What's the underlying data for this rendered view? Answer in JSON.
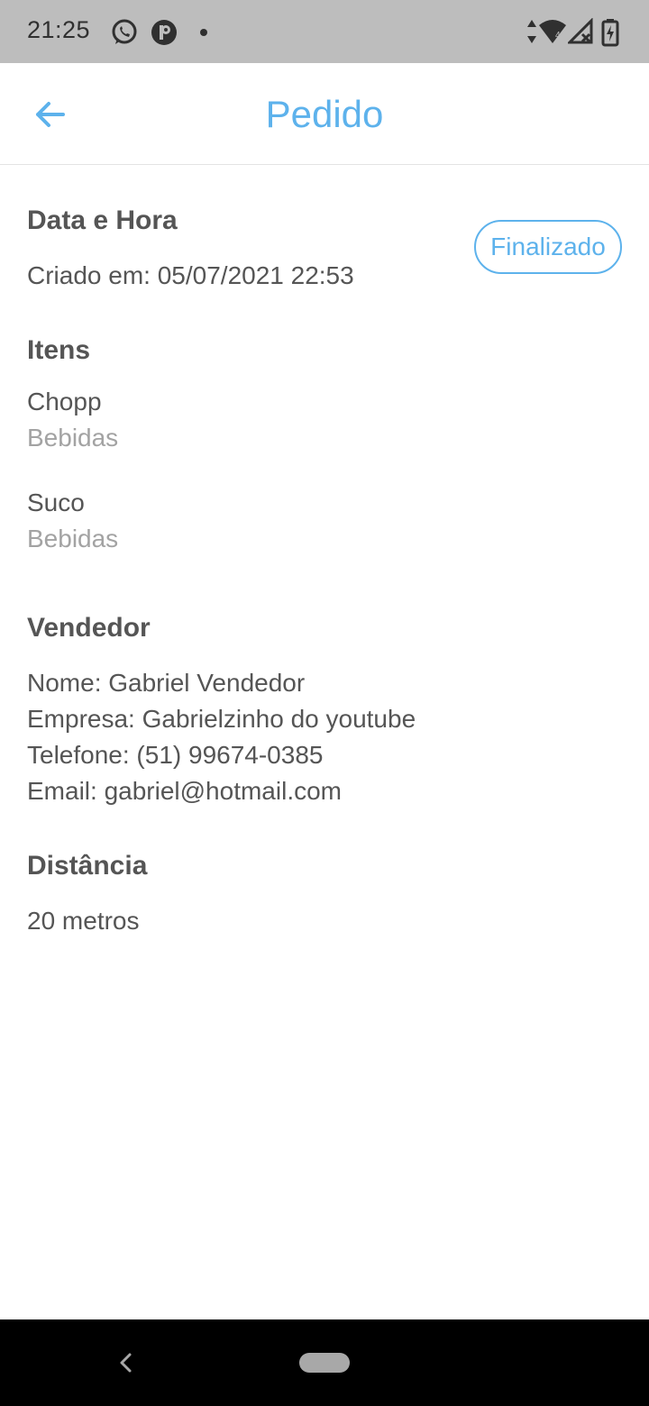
{
  "status_bar": {
    "time": "21:25",
    "icons": [
      "whatsapp-icon",
      "pinterest-icon",
      "notification-dot-icon",
      "data-arrows-icon",
      "wifi-icon",
      "signal-icon",
      "battery-icon"
    ]
  },
  "app_bar": {
    "title": "Pedido",
    "back_icon": "arrow-left-icon",
    "accent_color": "#5db2ec"
  },
  "order": {
    "datetime_title": "Data e Hora",
    "created_text": "Criado em: 05/07/2021 22:53",
    "status_label": "Finalizado",
    "items_title": "Itens",
    "items": [
      {
        "name": "Chopp",
        "category": "Bebidas"
      },
      {
        "name": "Suco",
        "category": "Bebidas"
      }
    ],
    "seller_title": "Vendedor",
    "seller": {
      "name_line": "Nome: Gabriel Vendedor",
      "company_line": "Empresa: Gabrielzinho do youtube",
      "phone_line": "Telefone: (51) 99674-0385",
      "email_line": "Email: gabriel@hotmail.com"
    },
    "distance_title": "Distância",
    "distance_value": "20 metros"
  },
  "nav_bar": {
    "back_icon": "nav-back-icon",
    "home_icon": "nav-home-pill-icon"
  }
}
